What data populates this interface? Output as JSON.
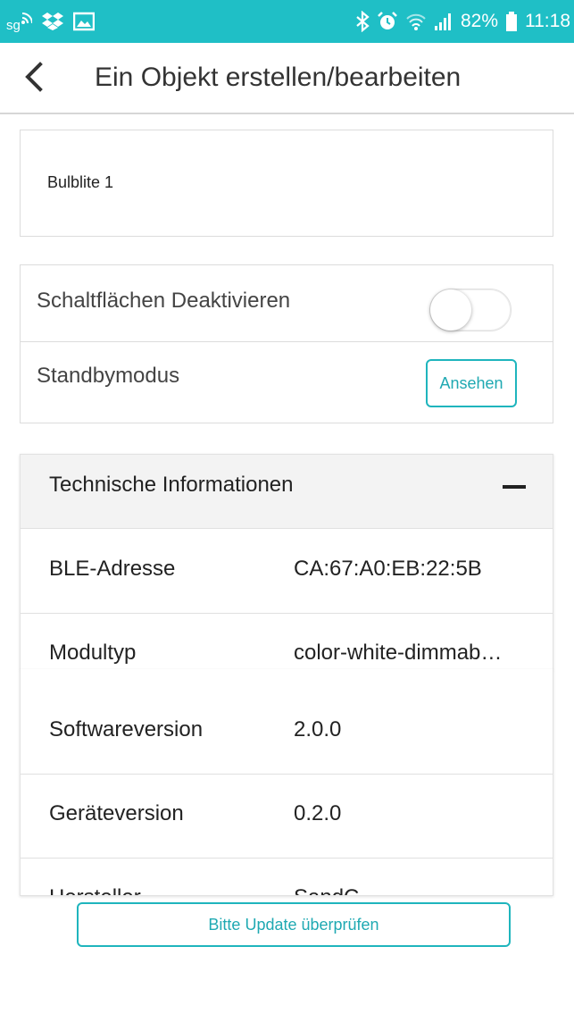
{
  "status_bar": {
    "battery_percent": "82%",
    "time": "11:18",
    "left_icons": [
      "sg-notification-icon",
      "dropbox-icon",
      "gallery-icon"
    ],
    "right_icons": [
      "bluetooth-icon",
      "alarm-icon",
      "wifi-icon",
      "signal-icon",
      "battery-icon"
    ],
    "background_color": "#1fbfc6"
  },
  "app_bar": {
    "back_icon": "chevron-left-icon",
    "title": "Ein Objekt erstellen/bearbeiten"
  },
  "name_card": {
    "value": "Bulblite 1"
  },
  "settings": {
    "disable_buttons_label": "Schaltflächen Deaktivieren",
    "disable_buttons_on": false,
    "standby_label": "Standbymodus",
    "standby_button": "Ansehen"
  },
  "tech_info": {
    "title": "Technische Informationen",
    "collapse_icon": "minus-icon",
    "rows": [
      {
        "key": "BLE-Adresse",
        "value": "CA:67:A0:EB:22:5B"
      },
      {
        "key": "Modultyp",
        "value": "color-white-dimmab…"
      },
      {
        "key": "Softwareversion",
        "value": "2.0.0"
      },
      {
        "key": "Geräteversion",
        "value": "0.2.0"
      },
      {
        "key": "Hersteller",
        "value": "SandC"
      }
    ]
  },
  "footer": {
    "update_button": "Bitte Update überprüfen"
  },
  "accent_color": "#1fb5bd"
}
